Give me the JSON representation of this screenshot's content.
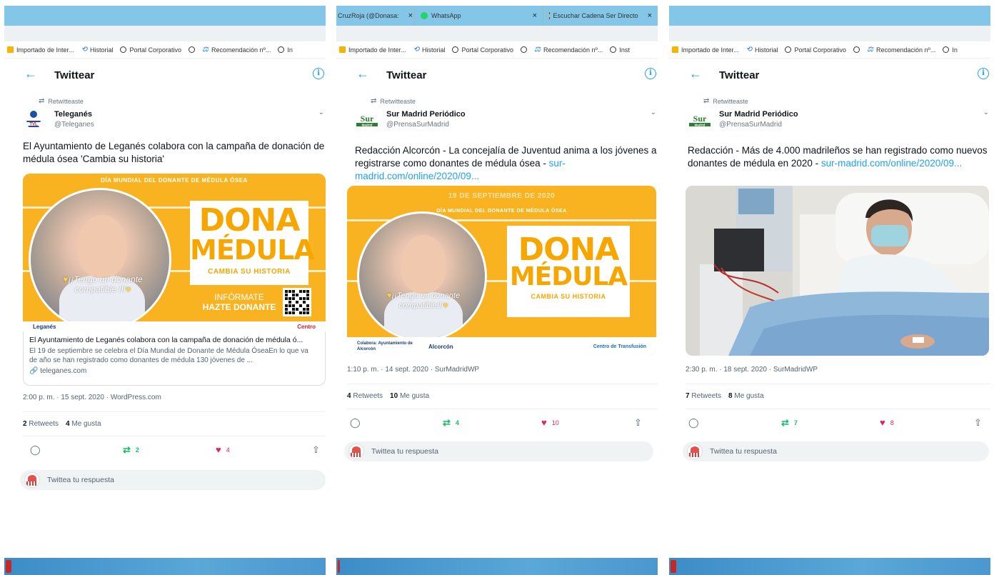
{
  "bookmarks": [
    "Importado de Inter...",
    "Historial",
    "Portal Corporativo",
    "",
    "Recomendación nº...",
    "In"
  ],
  "bookmarks_p2": [
    "Importado de Inter...",
    "Historial",
    "Portal Corporativo",
    "",
    "Recomendación nº...",
    "Inst"
  ],
  "tabs_p2": [
    {
      "label": "CruzRoja (@Donasa:",
      "close": "×"
    },
    {
      "label": "WhatsApp",
      "close": "×"
    },
    {
      "label": "Escuchar Cadena Ser Directo",
      "close": "×"
    }
  ],
  "header": {
    "title": "Twittear",
    "back": "←",
    "info": "i"
  },
  "retweeted_label": "Retwitteaste",
  "reply_placeholder": "Twittea tu respuesta",
  "retweets_label": "Retweets",
  "likes_label": "Me gusta",
  "tweets": [
    {
      "author": "Teleganés",
      "handle": "@Teleganes",
      "text": "El Ayuntamiento de Leganés colabora con la campaña de donación de médula ósea 'Cambia su historia'",
      "media": {
        "banner": "DÍA MUNDIAL DEL DONANTE DE MÉDULA ÓSEA",
        "bubble": "¡¡Tengo un donante compatible !!!",
        "dona": "DONA",
        "medula": "MÉDULA",
        "cambia": "CAMBIA SU HISTORIA",
        "informate": "INFÓRMATE",
        "hazte": "HAZTE DONANTE",
        "footer_left": "Leganés",
        "footer_right": "Centro"
      },
      "card": {
        "title": "El Ayuntamiento de Leganés colabora con la campaña de donación de médula ó...",
        "desc": "El 19 de septiembre se celebra el Día Mundial de Donante de Médula ÓseaEn lo que va de año se han registrado como donantes de médula 130 jóvenes de ...",
        "domain": "teleganes.com"
      },
      "meta": "2:00 p. m. · 15 sept. 2020 · WordPress.com",
      "retweets": "2",
      "likes": "4",
      "rt_count": "2",
      "like_count": "4"
    },
    {
      "author": "Sur Madrid Periódico",
      "handle": "@PrensaSurMadrid",
      "text": "Redacción Alcorcón - La concejalía de Juventud anima a los jóvenes a registrarse como donantes de médula ósea - ",
      "link": "sur-madrid.com/online/2020/09...",
      "media": {
        "date": "19 DE SEPTIEMBRE DE 2020",
        "banner": "DÍA MUNDIAL DEL DONANTE DE MÉDULA ÓSEA",
        "bubble": "¡¡Tengo un donante compatible!!!",
        "dona": "DONA",
        "medula": "MÉDULA",
        "cambia": "CAMBIA SU HISTORIA",
        "collab": "Colabora: Ayuntamiento de Alcorcón",
        "alcorcon": "Alcorcón",
        "centro": "Centro de Transfusión"
      },
      "meta": "1:10 p. m. · 14 sept. 2020 · SurMadridWP",
      "retweets": "4",
      "likes": "10",
      "rt_count": "4",
      "like_count": "10"
    },
    {
      "author": "Sur Madrid Periódico",
      "handle": "@PrensaSurMadrid",
      "text": "Redacción - Más de 4.000 madrileños se han registrado como nuevos donantes de médula en 2020 - ",
      "link": "sur-madrid.com/online/2020/09...",
      "meta": "2:30 p. m. · 18 sept. 2020 · SurMadridWP",
      "retweets": "7",
      "likes": "8",
      "rt_count": "7",
      "like_count": "8"
    }
  ],
  "colors": {
    "accent": "#1da1f2",
    "retweet": "#17bf63",
    "like": "#e0245e",
    "campaign_orange": "#f9b320"
  },
  "icons": [
    "back-arrow-icon",
    "info-icon",
    "retweet-icon",
    "chevron-down-icon",
    "reply-icon",
    "like-icon",
    "share-icon",
    "link-icon"
  ]
}
